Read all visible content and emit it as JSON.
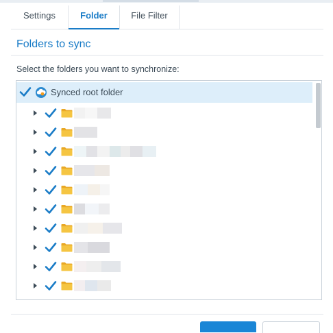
{
  "tabs": [
    {
      "label": "Settings",
      "active": false
    },
    {
      "label": "Folder",
      "active": true
    },
    {
      "label": "File Filter",
      "active": false
    }
  ],
  "section_title": "Folders to sync",
  "instruction": "Select the folders you want to synchronize:",
  "tree": {
    "root": {
      "label": "Synced root folder",
      "checked": true,
      "icon": "cloud-sync-icon"
    },
    "children_note_redacted": true,
    "children": [
      {
        "checked": true,
        "expandable": true,
        "icon": "folder-icon"
      },
      {
        "checked": true,
        "expandable": true,
        "icon": "folder-icon"
      },
      {
        "checked": true,
        "expandable": true,
        "icon": "folder-icon"
      },
      {
        "checked": true,
        "expandable": true,
        "icon": "folder-icon"
      },
      {
        "checked": true,
        "expandable": true,
        "icon": "folder-icon"
      },
      {
        "checked": true,
        "expandable": true,
        "icon": "folder-icon"
      },
      {
        "checked": true,
        "expandable": true,
        "icon": "folder-icon"
      },
      {
        "checked": true,
        "expandable": true,
        "icon": "folder-icon"
      },
      {
        "checked": true,
        "expandable": true,
        "icon": "folder-icon"
      },
      {
        "checked": true,
        "expandable": true,
        "icon": "folder-icon"
      }
    ]
  },
  "colors": {
    "accent": "#1a7cc7",
    "check": "#1a7cc7",
    "folder": "#f5c542",
    "selected_row": "#ddeefa"
  }
}
